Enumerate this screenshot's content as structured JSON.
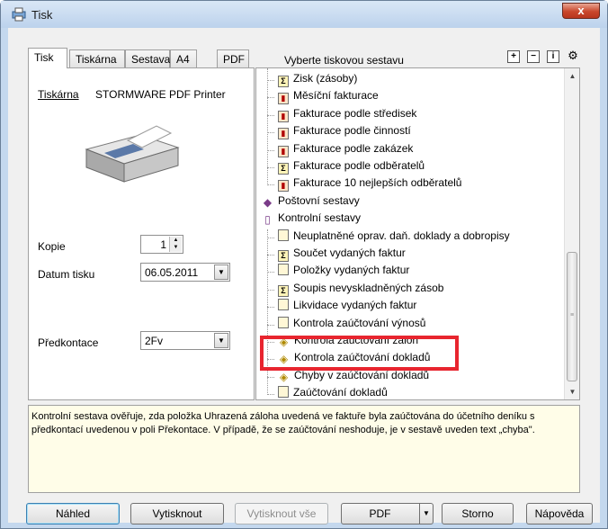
{
  "window": {
    "title": "Tisk",
    "close_glyph": "x"
  },
  "tabs": [
    {
      "label": "Tisk",
      "active": true
    },
    {
      "label": "Tiskárna",
      "active": false
    },
    {
      "label": "Sestava",
      "active": false
    },
    {
      "label": "A4",
      "active": false
    },
    {
      "label": "PDF",
      "active": false
    }
  ],
  "report_section_label": "Vyberte tiskovou sestavu",
  "toolbar_icons": [
    "expand-icon",
    "collapse-icon",
    "info-icon",
    "settings-icon"
  ],
  "toolbar_glyphs": [
    "+",
    "−",
    "i",
    "⚙"
  ],
  "left": {
    "printer_label": "Tiskárna",
    "printer_name": "STORMWARE PDF Printer",
    "copies_label": "Kopie",
    "copies_value": "1",
    "print_date_label": "Datum tisku",
    "print_date_value": "06.05.2011",
    "precontation_label": "Předkontace",
    "precontation_value": "2Fv"
  },
  "tree": [
    {
      "label": "Zisk (zásoby)",
      "icon": "sum",
      "level": 2
    },
    {
      "label": "Měsíční fakturace",
      "icon": "chart",
      "level": 2
    },
    {
      "label": "Fakturace podle středisek",
      "icon": "chart",
      "level": 2
    },
    {
      "label": "Fakturace podle činností",
      "icon": "chart",
      "level": 2
    },
    {
      "label": "Fakturace podle zakázek",
      "icon": "chart",
      "level": 2
    },
    {
      "label": "Fakturace podle odběratelů",
      "icon": "sum",
      "level": 2
    },
    {
      "label": "Fakturace 10 nejlepších odběratelů",
      "icon": "chart",
      "level": 2
    },
    {
      "label": "Poštovní sestavy",
      "icon": "book",
      "level": 1
    },
    {
      "label": "Kontrolní sestavy",
      "icon": "openbook",
      "level": 1
    },
    {
      "label": "Neuplatněné oprav. daň. doklady a dobropisy",
      "icon": "doc",
      "level": 2
    },
    {
      "label": "Součet vydaných faktur",
      "icon": "sum",
      "level": 2
    },
    {
      "label": "Položky vydaných faktur",
      "icon": "doc",
      "level": 2
    },
    {
      "label": "Soupis nevyskladněných zásob",
      "icon": "sum",
      "level": 2
    },
    {
      "label": "Likvidace vydaných faktur",
      "icon": "doc",
      "level": 2
    },
    {
      "label": "Kontrola zaúčtování výnosů",
      "icon": "doc",
      "level": 2
    },
    {
      "label": "Kontrola zaúčtování záloh",
      "icon": "warn",
      "level": 2,
      "selected": true
    },
    {
      "label": "Kontrola zaúčtování dokladů",
      "icon": "warn",
      "level": 2
    },
    {
      "label": "Chyby v zaúčtování dokladů",
      "icon": "warn",
      "level": 2
    },
    {
      "label": "Zaúčtování dokladů",
      "icon": "doc",
      "level": 2
    }
  ],
  "tree_glyphs": {
    "sum": "Σ",
    "chart": "▮",
    "doc": "",
    "warn": "◈",
    "book": "◆",
    "openbook": "▯"
  },
  "description_line1": "Kontrolní sestava ověřuje, zda položka Uhrazená záloha uvedená ve faktuře byla zaúčtována do účetního deníku s",
  "description_line2": "předkontací uvedenou v poli Překontace. V případě, že se zaúčtování neshoduje, je v sestavě uveden text „chyba\".",
  "buttons": {
    "preview": "Náhled",
    "print": "Vytisknout",
    "print_all": "Vytisknout vše",
    "pdf": "PDF",
    "cancel": "Storno",
    "help": "Nápověda"
  },
  "colors": {
    "highlight": "#e8252f",
    "titlebar": "#c4d8ee",
    "close": "#c9472c"
  }
}
